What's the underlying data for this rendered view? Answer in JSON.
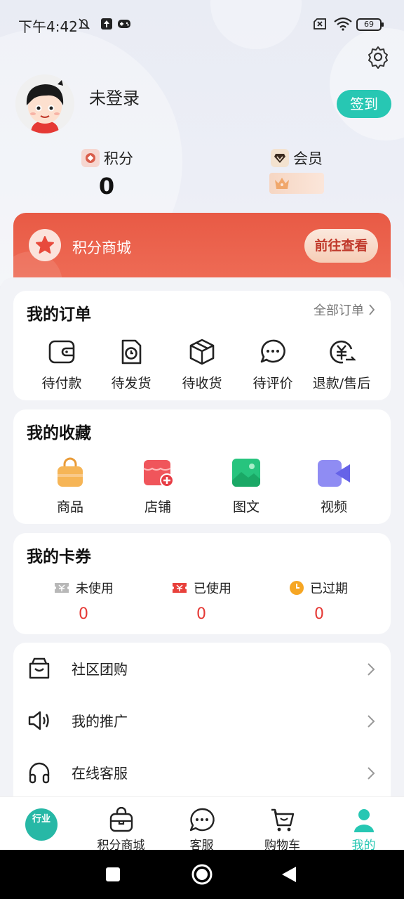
{
  "status_bar": {
    "time": "下午4:42",
    "battery": "69"
  },
  "header": {
    "login_text": "未登录",
    "sign_in_label": "签到",
    "points_label": "积分",
    "points_value": "0",
    "vip_label": "会员"
  },
  "mall_banner": {
    "title": "积分商城",
    "button_label": "前往查看"
  },
  "orders": {
    "title": "我的订单",
    "all_label": "全部订单",
    "items": [
      {
        "label": "待付款",
        "icon": "wallet-icon"
      },
      {
        "label": "待发货",
        "icon": "clock-doc-icon"
      },
      {
        "label": "待收货",
        "icon": "package-icon"
      },
      {
        "label": "待评价",
        "icon": "chat-icon"
      },
      {
        "label": "退款/售后",
        "icon": "refund-icon"
      }
    ]
  },
  "favorites": {
    "title": "我的收藏",
    "items": [
      {
        "label": "商品",
        "icon": "bag-icon",
        "color": "#f6b556"
      },
      {
        "label": "店铺",
        "icon": "shop-icon",
        "color": "#f0555b"
      },
      {
        "label": "图文",
        "icon": "image-icon",
        "color": "#27c47e"
      },
      {
        "label": "视频",
        "icon": "video-icon",
        "color": "#7a78ef"
      }
    ]
  },
  "coupons": {
    "title": "我的卡券",
    "items": [
      {
        "label": "未使用",
        "value": "0"
      },
      {
        "label": "已使用",
        "value": "0"
      },
      {
        "label": "已过期",
        "value": "0"
      }
    ]
  },
  "menu": [
    {
      "label": "社区团购",
      "icon": "basket-icon"
    },
    {
      "label": "我的推广",
      "icon": "speaker-icon"
    },
    {
      "label": "在线客服",
      "icon": "headset-icon"
    }
  ],
  "bottom_nav": {
    "logo_text": "行业",
    "items": [
      {
        "label": "积分商城"
      },
      {
        "label": "客服"
      },
      {
        "label": "购物车"
      },
      {
        "label": "我的"
      }
    ]
  },
  "colors": {
    "accent": "#27c7b3",
    "banner_red": "#e85a45",
    "coupon_value": "#e53935"
  }
}
